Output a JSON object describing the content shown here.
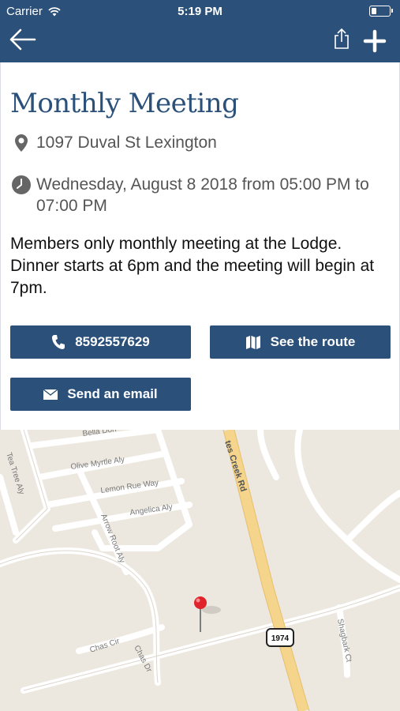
{
  "status_bar": {
    "carrier": "Carrier",
    "time": "5:19 PM"
  },
  "nav": {
    "back_icon": "arrow-left-icon",
    "share_icon": "share-icon",
    "add_icon": "plus-icon"
  },
  "event": {
    "title": "Monthly Meeting",
    "address": "1097 Duval St Lexington",
    "datetime": "Wednesday, August 8 2018 from 05:00 PM to 07:00 PM",
    "description": "Members only monthly meeting at the Lodge. Dinner starts at 6pm and the meeting will begin at 7pm."
  },
  "actions": {
    "phone_label": "8592557629",
    "route_label": "See the route",
    "email_label": "Send an email"
  },
  "map": {
    "streets": [
      "Bella Don",
      "Olive Myrtle Aly",
      "Lemon Rue Way",
      "Angelica Aly",
      "Arrow Root Aly",
      "Tea Tree Aly",
      "tes Creek Rd",
      "Chas Cir",
      "Chas Dr",
      "Shagbark Ct"
    ],
    "route_shield": "1974"
  },
  "colors": {
    "header": "#2b5079",
    "accent": "#2b5079",
    "pin": "#e0242c",
    "map_bg": "#ede8df"
  }
}
